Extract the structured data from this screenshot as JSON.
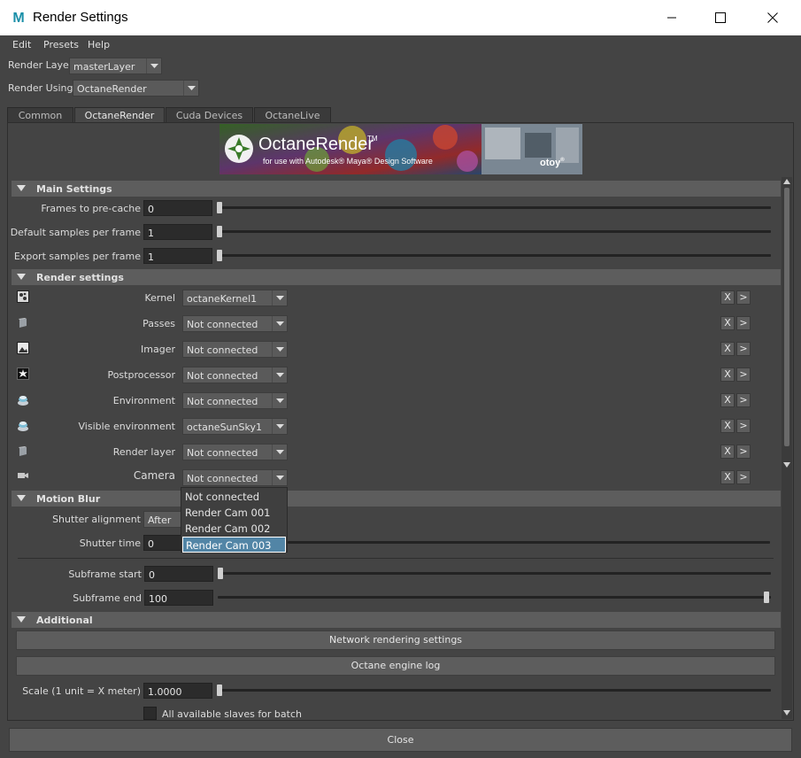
{
  "window": {
    "title": "Render Settings",
    "logo_letter": "M"
  },
  "menu": [
    "Edit",
    "Presets",
    "Help"
  ],
  "render_layer": {
    "label": "Render Layer",
    "value": "masterLayer"
  },
  "render_using": {
    "label": "Render Using",
    "value": "OctaneRender"
  },
  "tabs": [
    {
      "label": "Common",
      "active": false
    },
    {
      "label": "OctaneRender",
      "active": true
    },
    {
      "label": "Cuda Devices",
      "active": false
    },
    {
      "label": "OctaneLive",
      "active": false
    }
  ],
  "banner": {
    "title": "OctaneRender",
    "trademark": "TM",
    "subtitle": "for use with Autodesk® Maya® Design Software",
    "brand": "otoy",
    "brand_reg": "®"
  },
  "main_settings": {
    "header": "Main Settings",
    "rows": [
      {
        "label": "Frames to pre-cache",
        "value": "0"
      },
      {
        "label": "Default samples per frame",
        "value": "1"
      },
      {
        "label": "Export samples per frame",
        "value": "1"
      }
    ]
  },
  "render_settings": {
    "header": "Render settings",
    "rows": [
      {
        "icon": "kernel-icon",
        "label": "Kernel",
        "value": "octaneKernel1"
      },
      {
        "icon": "passes-icon",
        "label": "Passes",
        "value": "Not connected"
      },
      {
        "icon": "imager-icon",
        "label": "Imager",
        "value": "Not connected"
      },
      {
        "icon": "postprocessor-icon",
        "label": "Postprocessor",
        "value": "Not connected"
      },
      {
        "icon": "environment-icon",
        "label": "Environment",
        "value": "Not connected"
      },
      {
        "icon": "visible-environment-icon",
        "label": "Visible environment",
        "value": "octaneSunSky1"
      },
      {
        "icon": "render-layer-icon",
        "label": "Render layer",
        "value": "Not connected"
      },
      {
        "icon": "camera-icon",
        "label": "Camera",
        "value": "Not connected"
      }
    ],
    "x_label": "X",
    "go_label": ">"
  },
  "camera_dropdown": {
    "options": [
      "Not connected",
      "Render Cam 001",
      "Render Cam 002",
      "Render Cam 003"
    ],
    "highlighted_index": 3
  },
  "motion_blur": {
    "header": "Motion Blur",
    "shutter_alignment": {
      "label": "Shutter alignment",
      "value": "After"
    },
    "shutter_time": {
      "label": "Shutter time",
      "value": "0"
    },
    "subframe_start": {
      "label": "Subframe start",
      "value": "0"
    },
    "subframe_end": {
      "label": "Subframe end",
      "value": "100"
    }
  },
  "additional": {
    "header": "Additional",
    "network_button": "Network rendering settings",
    "log_button": "Octane engine log",
    "scale": {
      "label": "Scale (1 unit = X meter)",
      "value": "1.0000"
    },
    "slaves_checkbox": {
      "label": "All available slaves for batch",
      "checked": false
    }
  },
  "close_button": "Close",
  "colors": {
    "background": "#444444",
    "section_header": "#5d5d5d",
    "field": "#2b2b2b",
    "highlight": "#5285a6"
  }
}
